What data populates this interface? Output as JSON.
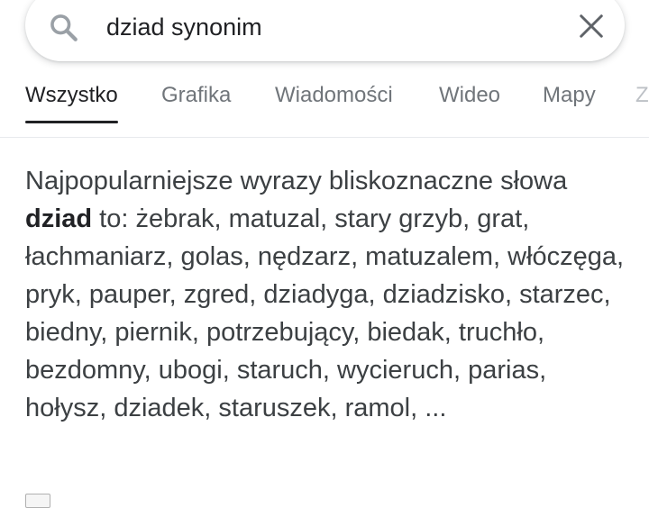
{
  "search": {
    "query": "dziad synonim",
    "icon": "search-icon",
    "clear_icon": "close-icon"
  },
  "tabs": [
    {
      "label": "Wszystko",
      "active": true
    },
    {
      "label": "Grafika",
      "active": false
    },
    {
      "label": "Wiadomości",
      "active": false
    },
    {
      "label": "Wideo",
      "active": false
    },
    {
      "label": "Mapy",
      "active": false
    },
    {
      "label": "Z",
      "active": false
    }
  ],
  "result": {
    "intro": "Najpopularniejsze wyrazy bliskoznaczne słowa",
    "keyword": "dziad",
    "body": " to: żebrak, matuzal, stary grzyb, grat, łachmaniarz, golas, nędzarz, matuzalem, włóczęga, pryk, pauper, zgred, dziadyga, dziadzisko, starzec, biedny, piernik, potrzebujący, biedak, truchło, bezdomny, ubogi, staruch, wycieruch, parias, hołysz, dziadek, staruszek, ramol, ..."
  },
  "colors": {
    "text_primary": "#202124",
    "text_secondary": "#70757a",
    "icon_gray": "#5f6368"
  }
}
